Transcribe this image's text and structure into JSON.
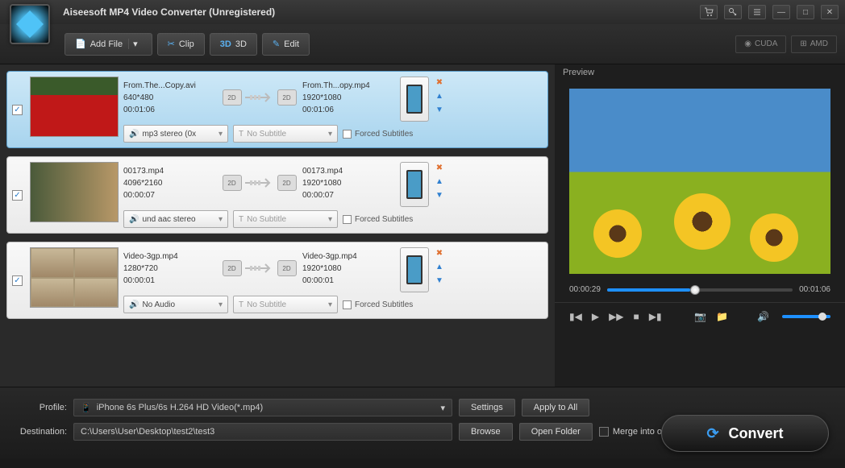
{
  "app": {
    "title": "Aiseesoft MP4 Video Converter (Unregistered)"
  },
  "toolbar": {
    "add_file": "Add File",
    "clip": "Clip",
    "three_d": "3D",
    "edit": "Edit",
    "cuda": "CUDA",
    "amd": "AMD"
  },
  "items": [
    {
      "src_name": "From.The...Copy.avi",
      "src_res": "640*480",
      "src_dur": "00:01:06",
      "dst_name": "From.Th...opy.mp4",
      "dst_res": "1920*1080",
      "dst_dur": "00:01:06",
      "audio": "mp3 stereo (0x",
      "subtitle": "No Subtitle",
      "forced": "Forced Subtitles",
      "selected": true
    },
    {
      "src_name": "00173.mp4",
      "src_res": "4096*2160",
      "src_dur": "00:00:07",
      "dst_name": "00173.mp4",
      "dst_res": "1920*1080",
      "dst_dur": "00:00:07",
      "audio": "und aac stereo",
      "subtitle": "No Subtitle",
      "forced": "Forced Subtitles",
      "selected": false
    },
    {
      "src_name": "Video-3gp.mp4",
      "src_res": "1280*720",
      "src_dur": "00:00:01",
      "dst_name": "Video-3gp.mp4",
      "dst_res": "1920*1080",
      "dst_dur": "00:00:01",
      "audio": "No Audio",
      "subtitle": "No Subtitle",
      "forced": "Forced Subtitles",
      "selected": false
    }
  ],
  "preview": {
    "label": "Preview",
    "current_time": "00:00:29",
    "total_time": "00:01:06"
  },
  "bottom": {
    "profile_label": "Profile:",
    "profile_value": "iPhone 6s Plus/6s H.264 HD Video(*.mp4)",
    "settings": "Settings",
    "apply_all": "Apply to All",
    "dest_label": "Destination:",
    "dest_value": "C:\\Users\\User\\Desktop\\test2\\test3",
    "browse": "Browse",
    "open_folder": "Open Folder",
    "merge": "Merge into one file",
    "convert": "Convert"
  },
  "badge_2d": "2D"
}
